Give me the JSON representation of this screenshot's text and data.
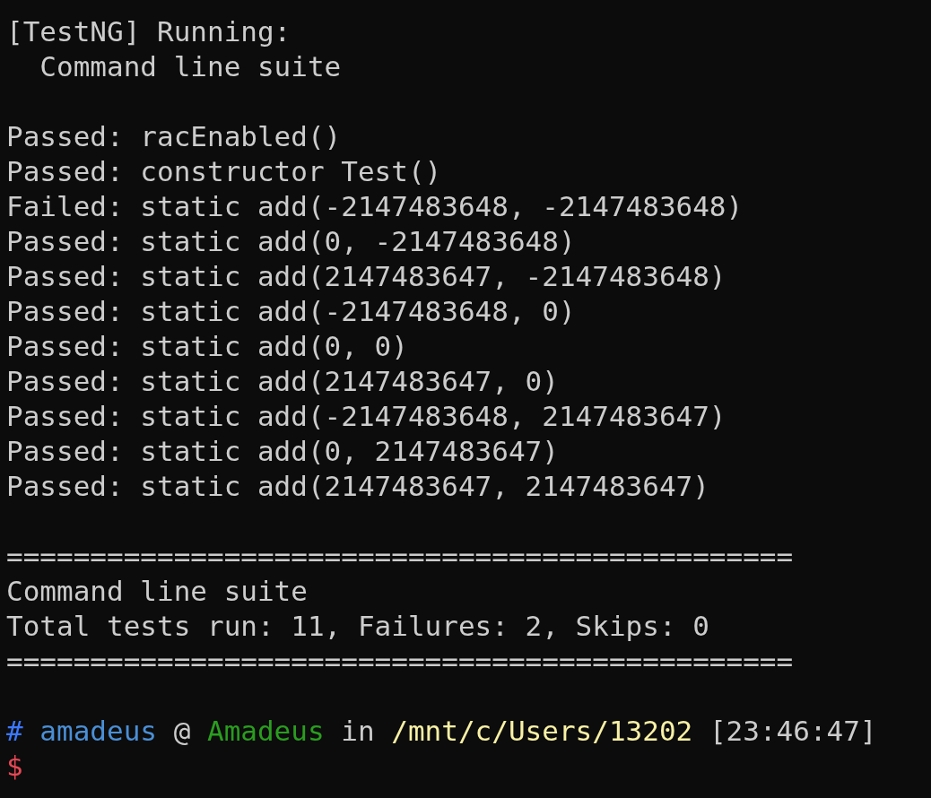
{
  "terminal": {
    "lines": [
      {
        "kind": "text",
        "text": "[TestNG] Running:"
      },
      {
        "kind": "text",
        "text": "  Command line suite"
      },
      {
        "kind": "blank"
      },
      {
        "kind": "text",
        "text": "Passed: racEnabled()"
      },
      {
        "kind": "text",
        "text": "Passed: constructor Test()"
      },
      {
        "kind": "text",
        "text": "Failed: static add(-2147483648, -2147483648)"
      },
      {
        "kind": "text",
        "text": "Passed: static add(0, -2147483648)"
      },
      {
        "kind": "text",
        "text": "Passed: static add(2147483647, -2147483648)"
      },
      {
        "kind": "text",
        "text": "Passed: static add(-2147483648, 0)"
      },
      {
        "kind": "text",
        "text": "Passed: static add(0, 0)"
      },
      {
        "kind": "text",
        "text": "Passed: static add(2147483647, 0)"
      },
      {
        "kind": "text",
        "text": "Passed: static add(-2147483648, 2147483647)"
      },
      {
        "kind": "text",
        "text": "Passed: static add(0, 2147483647)"
      },
      {
        "kind": "text",
        "text": "Passed: static add(2147483647, 2147483647)"
      },
      {
        "kind": "blank"
      },
      {
        "kind": "text",
        "text": "==============================================="
      },
      {
        "kind": "text",
        "text": "Command line suite"
      },
      {
        "kind": "text",
        "text": "Total tests run: 11, Failures: 2, Skips: 0"
      },
      {
        "kind": "text",
        "text": "==============================================="
      },
      {
        "kind": "blank"
      },
      {
        "kind": "prompt",
        "segments": [
          {
            "text": "#",
            "color": "#3b78ff"
          },
          {
            "text": "amadeus",
            "color": "#4a8fd6"
          },
          {
            "text": "@",
            "color": "#cccccc"
          },
          {
            "text": "Amadeus",
            "color": "#2a9d1f"
          },
          {
            "text": "in",
            "color": "#cccccc"
          },
          {
            "text": "/mnt/c/Users/13202",
            "color": "#f9f1a5"
          },
          {
            "text": "[23:46:47]",
            "color": "#cccccc"
          }
        ]
      },
      {
        "kind": "cursor",
        "segments": [
          {
            "text": "$",
            "color": "#e74856"
          }
        ]
      }
    ]
  }
}
